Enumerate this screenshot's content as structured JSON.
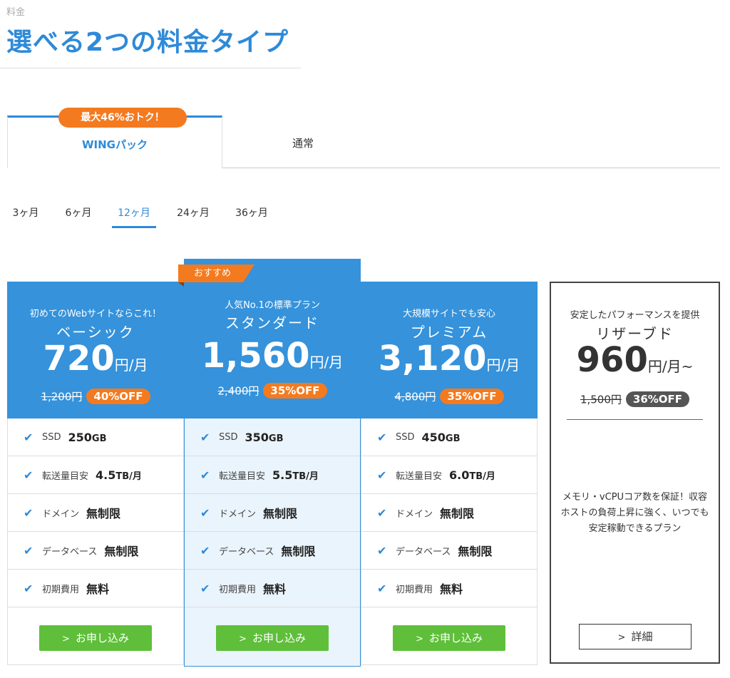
{
  "header": {
    "eyebrow": "料金",
    "title": "選べる2つの料金タイプ"
  },
  "tabs": {
    "promo": "最大46%おトク！",
    "wing": "WINGパック",
    "normal": "通常"
  },
  "terms": [
    "3ヶ月",
    "6ヶ月",
    "12ヶ月",
    "24ヶ月",
    "36ヶ月"
  ],
  "selected_term": "12ヶ月",
  "plans": [
    {
      "tagline": "初めてのWebサイトならこれ！",
      "name": "ベーシック",
      "price": "720",
      "unit": "円/月",
      "old_price": "1,200円",
      "discount": "40%OFF",
      "features": {
        "ssd_label": "SSD",
        "ssd_value": "250",
        "ssd_unit": "GB",
        "transfer_label": "転送量目安",
        "transfer_value": "4.5",
        "transfer_unit": "TB/月",
        "domain_label": "ドメイン",
        "domain_value": "無制限",
        "db_label": "データベース",
        "db_value": "無制限",
        "setup_label": "初期費用",
        "setup_value": "無料"
      },
      "button": "お申し込み"
    },
    {
      "badge": "おすすめ",
      "tagline": "人気No.1の標準プラン",
      "name": "スタンダード",
      "price": "1,560",
      "unit": "円/月",
      "old_price": "2,400円",
      "discount": "35%OFF",
      "features": {
        "ssd_label": "SSD",
        "ssd_value": "350",
        "ssd_unit": "GB",
        "transfer_label": "転送量目安",
        "transfer_value": "5.5",
        "transfer_unit": "TB/月",
        "domain_label": "ドメイン",
        "domain_value": "無制限",
        "db_label": "データベース",
        "db_value": "無制限",
        "setup_label": "初期費用",
        "setup_value": "無料"
      },
      "button": "お申し込み"
    },
    {
      "tagline": "大規模サイトでも安心",
      "name": "プレミアム",
      "price": "3,120",
      "unit": "円/月",
      "old_price": "4,800円",
      "discount": "35%OFF",
      "features": {
        "ssd_label": "SSD",
        "ssd_value": "450",
        "ssd_unit": "GB",
        "transfer_label": "転送量目安",
        "transfer_value": "6.0",
        "transfer_unit": "TB/月",
        "domain_label": "ドメイン",
        "domain_value": "無制限",
        "db_label": "データベース",
        "db_value": "無制限",
        "setup_label": "初期費用",
        "setup_value": "無料"
      },
      "button": "お申し込み"
    }
  ],
  "reserved": {
    "tagline": "安定したパフォーマンスを提供",
    "name": "リザーブド",
    "price": "960",
    "unit": "円/月~",
    "old_price": "1,500円",
    "discount": "36%OFF",
    "description": "メモリ・vCPUコア数を保証！収容ホストの負荷上昇に強く、いつでも安定稼動できるプラン",
    "button": "詳細"
  },
  "colors": {
    "accent": "#2e8ad8",
    "plan_header": "#3592db",
    "promo": "#f47a20",
    "cta": "#5fbf3b",
    "featured_bg": "#eaf4fc"
  }
}
